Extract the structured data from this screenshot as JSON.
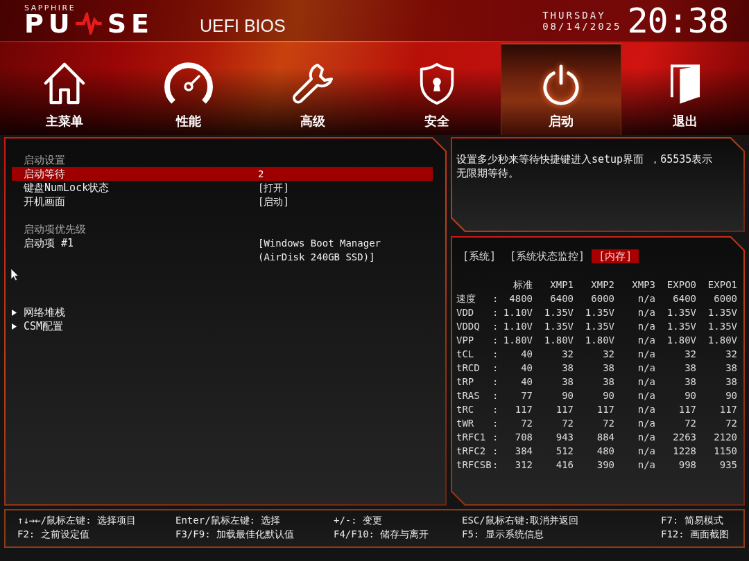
{
  "header": {
    "logo": {
      "brand": "SAPPHIRE",
      "word_start": "PU",
      "word_end": "SE"
    },
    "title": "UEFI BIOS",
    "clock": {
      "day": "THURSDAY",
      "date": "08/14/2025",
      "time": "20:38"
    }
  },
  "tabs": [
    {
      "label": "主菜单",
      "selected": false
    },
    {
      "label": "性能",
      "selected": false
    },
    {
      "label": "高级",
      "selected": false
    },
    {
      "label": "安全",
      "selected": false
    },
    {
      "label": "启动",
      "selected": true
    },
    {
      "label": "退出",
      "selected": false
    }
  ],
  "settings": {
    "items": [
      {
        "kind": "heading",
        "label": "启动设置"
      },
      {
        "kind": "option",
        "label": "启动等待",
        "value": "2",
        "selected": true
      },
      {
        "kind": "option",
        "label": "键盘NumLock状态",
        "value": "[打开]",
        "selected": false
      },
      {
        "kind": "option",
        "label": "开机画面",
        "value": "[启动]",
        "selected": false
      },
      {
        "kind": "heading",
        "label": "启动项优先级"
      },
      {
        "kind": "option",
        "label": "启动项 #1",
        "value": "[Windows Boot Manager\n(AirDisk 240GB SSD)]",
        "selected": false
      },
      {
        "kind": "submenu",
        "label": "网络堆栈",
        "selected": false
      },
      {
        "kind": "submenu",
        "label": "CSM配置",
        "selected": false
      }
    ]
  },
  "help": {
    "text": "设置多少秒来等待快捷键进入setup界面 ，65535表示无限期等待。"
  },
  "info": {
    "tabs": [
      {
        "label": "[系统]",
        "selected": false
      },
      {
        "label": "[系统状态监控]",
        "selected": false
      },
      {
        "label": "[内存]",
        "selected": true
      }
    ],
    "table": {
      "columns": [
        "标准",
        "XMP1",
        "XMP2",
        "XMP3",
        "EXPO0",
        "EXPO1"
      ],
      "rows": [
        {
          "label": "速度",
          "separator": ":",
          "values": [
            "4800",
            "6400",
            "6000",
            "n/a",
            "6400",
            "6000"
          ]
        },
        {
          "label": "VDD",
          "separator": ":",
          "values": [
            "1.10V",
            "1.35V",
            "1.35V",
            "n/a",
            "1.35V",
            "1.35V"
          ]
        },
        {
          "label": "VDDQ",
          "separator": ":",
          "values": [
            "1.10V",
            "1.35V",
            "1.35V",
            "n/a",
            "1.35V",
            "1.35V"
          ]
        },
        {
          "label": "VPP",
          "separator": ":",
          "values": [
            "1.80V",
            "1.80V",
            "1.80V",
            "n/a",
            "1.80V",
            "1.80V"
          ]
        },
        {
          "label": "tCL",
          "separator": ":",
          "values": [
            "40",
            "32",
            "32",
            "n/a",
            "32",
            "32"
          ]
        },
        {
          "label": "tRCD",
          "separator": ":",
          "values": [
            "40",
            "38",
            "38",
            "n/a",
            "38",
            "38"
          ]
        },
        {
          "label": "tRP",
          "separator": ":",
          "values": [
            "40",
            "38",
            "38",
            "n/a",
            "38",
            "38"
          ]
        },
        {
          "label": "tRAS",
          "separator": ":",
          "values": [
            "77",
            "90",
            "90",
            "n/a",
            "90",
            "90"
          ]
        },
        {
          "label": "tRC",
          "separator": ":",
          "values": [
            "117",
            "117",
            "117",
            "n/a",
            "117",
            "117"
          ]
        },
        {
          "label": "tWR",
          "separator": ":",
          "values": [
            "72",
            "72",
            "72",
            "n/a",
            "72",
            "72"
          ]
        },
        {
          "label": "tRFC1",
          "separator": ":",
          "values": [
            "708",
            "943",
            "884",
            "n/a",
            "2263",
            "2120"
          ]
        },
        {
          "label": "tRFC2",
          "separator": ":",
          "values": [
            "384",
            "512",
            "480",
            "n/a",
            "1228",
            "1150"
          ]
        },
        {
          "label": "tRFCSB",
          "separator": ":",
          "values": [
            "312",
            "416",
            "390",
            "n/a",
            "998",
            "935"
          ]
        }
      ]
    }
  },
  "footer": {
    "columns": [
      [
        "↑↓→←/鼠标左键: 选择项目",
        "F2: 之前设定值"
      ],
      [
        "Enter/鼠标左键: 选择",
        "F3/F9: 加载最佳化默认值"
      ],
      [
        "+/-: 变更",
        "F4/F10: 储存与离开"
      ],
      [
        "ESC/鼠标右键:取消并返回",
        "F5: 显示系统信息"
      ],
      [
        "F7: 简易模式",
        "F12: 画面截图"
      ]
    ]
  }
}
